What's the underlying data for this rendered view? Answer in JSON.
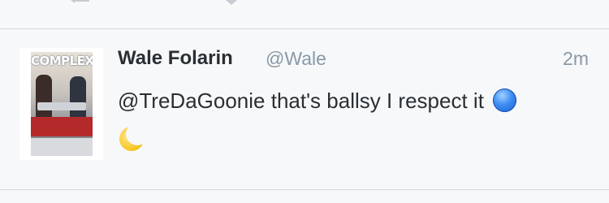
{
  "tweet": {
    "display_name": "Wale Folarin",
    "screen_name": "@Wale",
    "timestamp": "2m",
    "text": "@TreDaGoonie that's ballsy I respect it",
    "emojis": [
      "blue-circle-icon",
      "crescent-moon-icon"
    ],
    "avatar": {
      "title": "COMPLEX"
    }
  },
  "actions": [
    "reply-icon",
    "retweet-icon",
    "favorite-icon"
  ],
  "colors": {
    "background": "#f7f8fa",
    "name": "#292f33",
    "meta": "#8899a6",
    "divider": "#d6d8dc"
  }
}
